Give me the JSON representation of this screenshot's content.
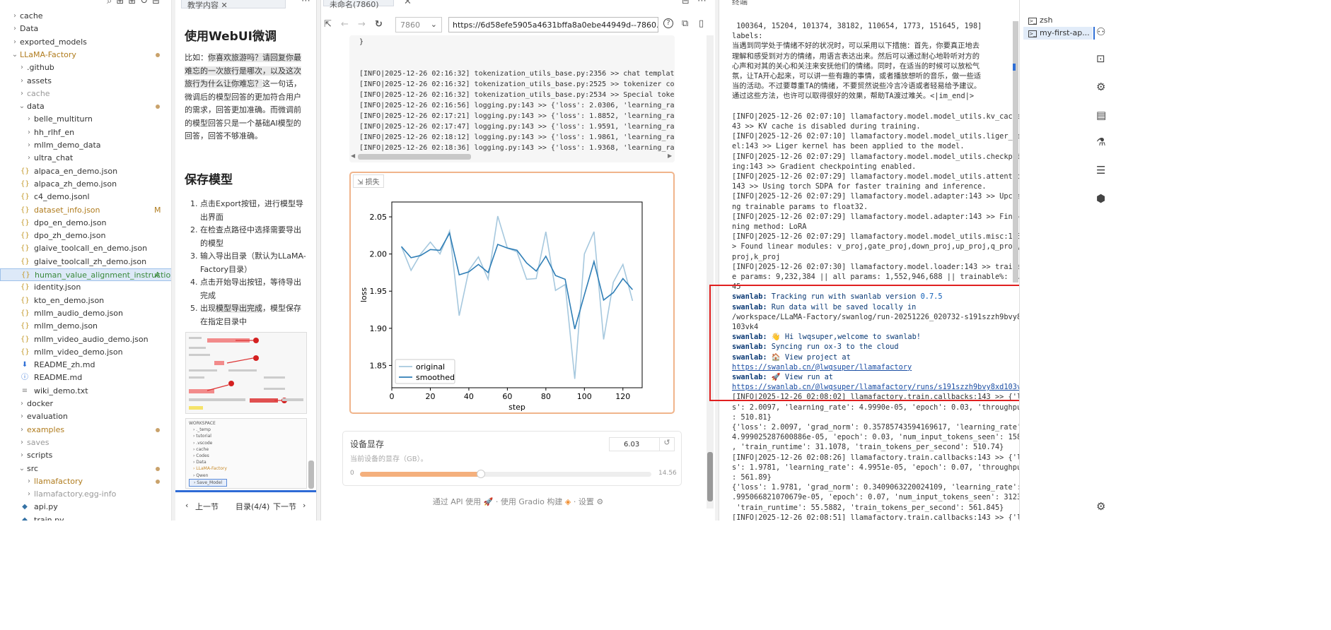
{
  "explorer": {
    "items": [
      {
        "label": "cache",
        "kind": "folder-closed",
        "level": 1,
        "color": "#333"
      },
      {
        "label": "Data",
        "kind": "folder-closed",
        "level": 1,
        "color": "#333"
      },
      {
        "label": "exported_models",
        "kind": "folder-closed",
        "level": 1,
        "color": "#333"
      },
      {
        "label": "LLaMA-Factory",
        "kind": "folder-open",
        "level": 1,
        "color": "#b07c1e",
        "dot": true
      },
      {
        "label": ".github",
        "kind": "folder-closed",
        "level": 2,
        "color": "#333"
      },
      {
        "label": "assets",
        "kind": "folder-closed",
        "level": 2,
        "color": "#333"
      },
      {
        "label": "cache",
        "kind": "folder-closed",
        "level": 2,
        "color": "#999"
      },
      {
        "label": "data",
        "kind": "folder-open",
        "level": 2,
        "color": "#333",
        "dot": true
      },
      {
        "label": "belle_multiturn",
        "kind": "folder-closed",
        "level": 3,
        "color": "#333"
      },
      {
        "label": "hh_rlhf_en",
        "kind": "folder-closed",
        "level": 3,
        "color": "#333"
      },
      {
        "label": "mllm_demo_data",
        "kind": "folder-closed",
        "level": 3,
        "color": "#333"
      },
      {
        "label": "ultra_chat",
        "kind": "folder-closed",
        "level": 3,
        "color": "#333"
      },
      {
        "label": "alpaca_en_demo.json",
        "kind": "json",
        "level": 3,
        "color": "#333"
      },
      {
        "label": "alpaca_zh_demo.json",
        "kind": "json",
        "level": 3,
        "color": "#333"
      },
      {
        "label": "c4_demo.jsonl",
        "kind": "json",
        "level": 3,
        "color": "#333"
      },
      {
        "label": "dataset_info.json",
        "kind": "json",
        "level": 3,
        "color": "#b07c1e",
        "badge": "M"
      },
      {
        "label": "dpo_en_demo.json",
        "kind": "json",
        "level": 3,
        "color": "#333"
      },
      {
        "label": "dpo_zh_demo.json",
        "kind": "json",
        "level": 3,
        "color": "#333"
      },
      {
        "label": "glaive_toolcall_en_demo.json",
        "kind": "json",
        "level": 3,
        "color": "#333"
      },
      {
        "label": "glaive_toolcall_zh_demo.json",
        "kind": "json",
        "level": 3,
        "color": "#333"
      },
      {
        "label": "human_value_alignment_instructio...",
        "kind": "json",
        "level": 3,
        "color": "#3a8a3a",
        "badge": "A",
        "selected": true
      },
      {
        "label": "identity.json",
        "kind": "json",
        "level": 3,
        "color": "#333"
      },
      {
        "label": "kto_en_demo.json",
        "kind": "json",
        "level": 3,
        "color": "#333"
      },
      {
        "label": "mllm_audio_demo.json",
        "kind": "json",
        "level": 3,
        "color": "#333"
      },
      {
        "label": "mllm_demo.json",
        "kind": "json",
        "level": 3,
        "color": "#333"
      },
      {
        "label": "mllm_video_audio_demo.json",
        "kind": "json",
        "level": 3,
        "color": "#333"
      },
      {
        "label": "mllm_video_demo.json",
        "kind": "json",
        "level": 3,
        "color": "#333"
      },
      {
        "label": "README_zh.md",
        "kind": "md-down",
        "level": 3,
        "color": "#333"
      },
      {
        "label": "README.md",
        "kind": "md-info",
        "level": 3,
        "color": "#333"
      },
      {
        "label": "wiki_demo.txt",
        "kind": "txt",
        "level": 3,
        "color": "#333"
      },
      {
        "label": "docker",
        "kind": "folder-closed",
        "level": 2,
        "color": "#333"
      },
      {
        "label": "evaluation",
        "kind": "folder-closed",
        "level": 2,
        "color": "#333"
      },
      {
        "label": "examples",
        "kind": "folder-closed",
        "level": 2,
        "color": "#b07c1e",
        "dot": true
      },
      {
        "label": "saves",
        "kind": "folder-closed",
        "level": 2,
        "color": "#999"
      },
      {
        "label": "scripts",
        "kind": "folder-closed",
        "level": 2,
        "color": "#333"
      },
      {
        "label": "src",
        "kind": "folder-open",
        "level": 2,
        "color": "#333",
        "dot": true
      },
      {
        "label": "llamafactory",
        "kind": "folder-closed",
        "level": 3,
        "color": "#b07c1e",
        "dot": true
      },
      {
        "label": "llamafactory.egg-info",
        "kind": "folder-closed",
        "level": 3,
        "color": "#999"
      },
      {
        "label": "api.py",
        "kind": "py",
        "level": 3,
        "color": "#333"
      },
      {
        "label": "train.py",
        "kind": "py",
        "level": 3,
        "color": "#333"
      }
    ]
  },
  "tutorial": {
    "tab_label": "教学内容",
    "heading1": "使用WebUI微调",
    "para_lead": "比如：",
    "para_highlight": "你喜欢旅游吗？请回复你最难忘的一次旅行是哪次，以及这次旅行为什么让你难忘？",
    "para_rest": "这一句话，微调后的模型回答的更加符合用户的需求，回答更加准确。而微调前的模型回答只是一个基础AI模型的回答，回答不够准确。",
    "heading2": "保存模型",
    "steps": [
      "点击Export按钮，进行模型导出界面",
      "在检查点路径中选择需要导出的模型",
      "输入导出目录（默认为LLaMA-Factory目录）",
      "点击开始导出按钮，等待导出完成"
    ],
    "step5_pre": "出现",
    "step5_hl": "模型导出完成",
    "step5_post": "，模型保存在指定目录中",
    "thumb2_items": [
      "WORKSPACE",
      "._temp",
      "tutorial",
      ".vscode",
      "cache",
      "Codes",
      "Data",
      "LLaMA-Factory",
      "Qwen",
      "Save_Model"
    ],
    "pager_prev": "上一节",
    "pager_toc": "目录(4/4)",
    "pager_next": "下一节"
  },
  "browser": {
    "tab_label": "未命名(7860)",
    "port": "7860",
    "url": "https://6d58efe5905a4631bffa8a0ebe44949d--7860.ap-sha",
    "log_lines": [
      "}",
      "",
      "",
      "[INFO|2025-12-26 02:16:32] tokenization_utils_base.py:2356 >> chat template",
      "[INFO|2025-12-26 02:16:32] tokenization_utils_base.py:2525 >> tokenizer con",
      "[INFO|2025-12-26 02:16:32] tokenization_utils_base.py:2534 >> Special token",
      "[INFO|2025-12-26 02:16:56] logging.py:143 >> {'loss': 2.0306, 'learning_rat",
      "[INFO|2025-12-26 02:17:21] logging.py:143 >> {'loss': 1.8852, 'learning_rat",
      "[INFO|2025-12-26 02:17:47] logging.py:143 >> {'loss': 1.9591, 'learning_rat",
      "[INFO|2025-12-26 02:18:12] logging.py:143 >> {'loss': 1.9861, 'learning_rat",
      "[INFO|2025-12-26 02:18:36] logging.py:143 >> {'loss': 1.9368, 'learning_rat"
    ],
    "chart_tag": "损失",
    "memory_title": "设备显存",
    "memory_sub": "当前设备的显存（GB）。",
    "memory_value": "6.03",
    "memory_min": "0",
    "memory_max": "14.56",
    "memory_fraction": 0.414,
    "footer_api": "通过 API 使用",
    "footer_gradio": "使用 Gradio 构建",
    "footer_settings": "设置"
  },
  "chart_data": {
    "type": "line",
    "xlabel": "step",
    "ylabel": "loss",
    "xlim": [
      0,
      130
    ],
    "ylim": [
      1.82,
      2.07
    ],
    "xticks": [
      0,
      20,
      40,
      60,
      80,
      100,
      120
    ],
    "yticks": [
      1.85,
      1.9,
      1.95,
      2.0,
      2.05
    ],
    "legend_position": "bottom-left",
    "series": [
      {
        "name": "original",
        "color": "#a6c8de",
        "x": [
          5,
          10,
          15,
          20,
          25,
          30,
          35,
          40,
          45,
          50,
          55,
          60,
          65,
          70,
          75,
          80,
          85,
          90,
          95,
          100,
          105,
          110,
          115,
          120,
          125
        ],
        "y": [
          2.01,
          1.978,
          2.0,
          2.016,
          2.0,
          2.031,
          1.917,
          1.978,
          1.996,
          1.966,
          2.051,
          2.008,
          2.003,
          1.966,
          1.967,
          2.03,
          1.951,
          1.959,
          1.832,
          2.0,
          2.03,
          1.885,
          1.962,
          1.986,
          1.937
        ]
      },
      {
        "name": "smoothed",
        "color": "#2f7eb6",
        "x": [
          5,
          10,
          15,
          20,
          25,
          30,
          35,
          40,
          45,
          50,
          55,
          60,
          65,
          70,
          75,
          80,
          85,
          90,
          95,
          100,
          105,
          110,
          115,
          120,
          125
        ],
        "y": [
          2.01,
          1.995,
          1.998,
          2.006,
          2.005,
          2.028,
          1.972,
          1.976,
          1.986,
          1.975,
          2.013,
          2.008,
          2.005,
          1.988,
          1.977,
          1.997,
          1.971,
          1.966,
          1.899,
          1.945,
          1.99,
          1.938,
          1.948,
          1.967,
          1.952
        ]
      }
    ]
  },
  "terminal": {
    "panel_title": "终端",
    "lines": [
      {
        "t": " 100364, 15204, 101374, 38182, 110654, 1773, 151645, 198]",
        "c": "plain"
      },
      {
        "t": "labels:",
        "c": "plain"
      },
      {
        "t": "当遇到同学处于情绪不好的状况时，可以采用以下措施：首先，你要真正地去",
        "c": "plain"
      },
      {
        "t": "理解和感受到对方的情绪，用语言表达出来。然后可以通过耐心地聆听对方的",
        "c": "plain"
      },
      {
        "t": "心声和对其的关心和关注来安抚他们的情绪。同时，在适当的时候可以放松气",
        "c": "plain"
      },
      {
        "t": "氛，让TA开心起来，可以讲一些有趣的事情，或者播放想听的音乐，做一些适",
        "c": "plain"
      },
      {
        "t": "当的活动。不过要尊重TA的情绪，不要贸然说些冷言冷语或者轻易给予建议。",
        "c": "plain"
      },
      {
        "t": "通过这些方法，也许可以取得很好的效果，帮助TA渡过难关。<|im_end|>",
        "c": "plain"
      },
      {
        "t": "",
        "c": "plain"
      },
      {
        "t": "[INFO|2025-12-26 02:07:10] llamafactory.model.model_utils.kv_cache:1",
        "c": "plain"
      },
      {
        "t": "43 >> KV cache is disabled during training.",
        "c": "plain"
      },
      {
        "t": "[INFO|2025-12-26 02:07:10] llamafactory.model.model_utils.liger_kerne",
        "c": "plain"
      },
      {
        "t": "el:143 >> Liger kernel has been applied to the model.",
        "c": "plain"
      },
      {
        "t": "[INFO|2025-12-26 02:07:29] llamafactory.model.model_utils.checkpoint",
        "c": "plain"
      },
      {
        "t": "ing:143 >> Gradient checkpointing enabled.",
        "c": "plain"
      },
      {
        "t": "[INFO|2025-12-26 02:07:29] llamafactory.model.model_utils.attention:",
        "c": "plain"
      },
      {
        "t": "143 >> Using torch SDPA for faster training and inference.",
        "c": "plain"
      },
      {
        "t": "[INFO|2025-12-26 02:07:29] llamafactory.model.adapter:143 >> Upcasti",
        "c": "plain"
      },
      {
        "t": "ng trainable params to float32.",
        "c": "plain"
      },
      {
        "t": "[INFO|2025-12-26 02:07:29] llamafactory.model.adapter:143 >> Fine-tu",
        "c": "plain"
      },
      {
        "t": "ning method: LoRA",
        "c": "plain"
      },
      {
        "t": "[INFO|2025-12-26 02:07:29] llamafactory.model.model_utils.misc:143 >",
        "c": "plain"
      },
      {
        "t": "> Found linear modules: v_proj,gate_proj,down_proj,up_proj,q_proj,o_",
        "c": "plain"
      },
      {
        "t": "proj,k_proj",
        "c": "plain"
      },
      {
        "t": "[INFO|2025-12-26 02:07:30] llamafactory.model.loader:143 >> trainabl",
        "c": "plain"
      },
      {
        "t": "e params: 9,232,384 || all params: 1,552,946,688 || trainable%: 0.59",
        "c": "plain"
      },
      {
        "t": "45",
        "c": "plain"
      },
      {
        "t": "Tracking run with swanlab version ",
        "c": "swan",
        "v": "0.7.5"
      },
      {
        "t": "Run data will be saved locally in",
        "c": "swan"
      },
      {
        "t": "/workspace/LLaMA-Factory/swanlog/run-20251226_020732-s191szzh9bvy8xd",
        "c": "purple"
      },
      {
        "t": "103vk4",
        "c": "purple"
      },
      {
        "t": "👋 Hi lwqsuper,welcome to swanlab!",
        "c": "swan"
      },
      {
        "t": "Syncing run ox-3 to the cloud",
        "c": "swan"
      },
      {
        "t": "🏠 View project at",
        "c": "swan"
      },
      {
        "t": "https://swanlab.cn/@lwqsuper/llamafactory",
        "c": "link"
      },
      {
        "t": "🚀 View run at",
        "c": "swan"
      },
      {
        "t": "https://swanlab.cn/@lwqsuper/llamafactory/runs/s191szzh9bvy8xd103vk4",
        "c": "link"
      },
      {
        "t": "[INFO|2025-12-26 02:08:02] llamafactory.train.callbacks:143 >> {'los",
        "c": "plain"
      },
      {
        "t": "s': 2.0097, 'learning_rate': 4.9990e-05, 'epoch': 0.03, 'throughput'",
        "c": "plain"
      },
      {
        "t": ": 510.81}",
        "c": "plain"
      },
      {
        "t": "{'loss': 2.0097, 'grad_norm': 0.35785743594169617, 'learning_rate':",
        "c": "plain"
      },
      {
        "t": "4.999025287600886e-05, 'epoch': 0.03, 'num_input_tokens_seen': 15888",
        "c": "plain"
      },
      {
        "t": ", 'train_runtime': 31.1078, 'train_tokens_per_second': 510.74}",
        "c": "plain"
      },
      {
        "t": "[INFO|2025-12-26 02:08:26] llamafactory.train.callbacks:143 >> {'los",
        "c": "plain"
      },
      {
        "t": "s': 1.9781, 'learning_rate': 4.9951e-05, 'epoch': 0.07, 'throughput'",
        "c": "plain"
      },
      {
        "t": ": 561.89}",
        "c": "plain"
      },
      {
        "t": "{'loss': 1.9781, 'grad_norm': 0.3409063220024109, 'learning_rate': 4",
        "c": "plain"
      },
      {
        "t": ".995066821070679e-05, 'epoch': 0.07, 'num_input_tokens_seen': 31232,",
        "c": "plain"
      },
      {
        "t": " 'train_runtime': 55.5882, 'train_tokens_per_second': 561.845}",
        "c": "plain"
      },
      {
        "t": "[INFO|2025-12-26 02:08:51] llamafactory.train.callbacks:143 >> {'los",
        "c": "plain"
      }
    ],
    "swan_prefix": "swanlab:"
  },
  "terminal_list": {
    "items": [
      {
        "label": "zsh"
      },
      {
        "label": "my-first-ap...",
        "selected": true
      }
    ]
  }
}
